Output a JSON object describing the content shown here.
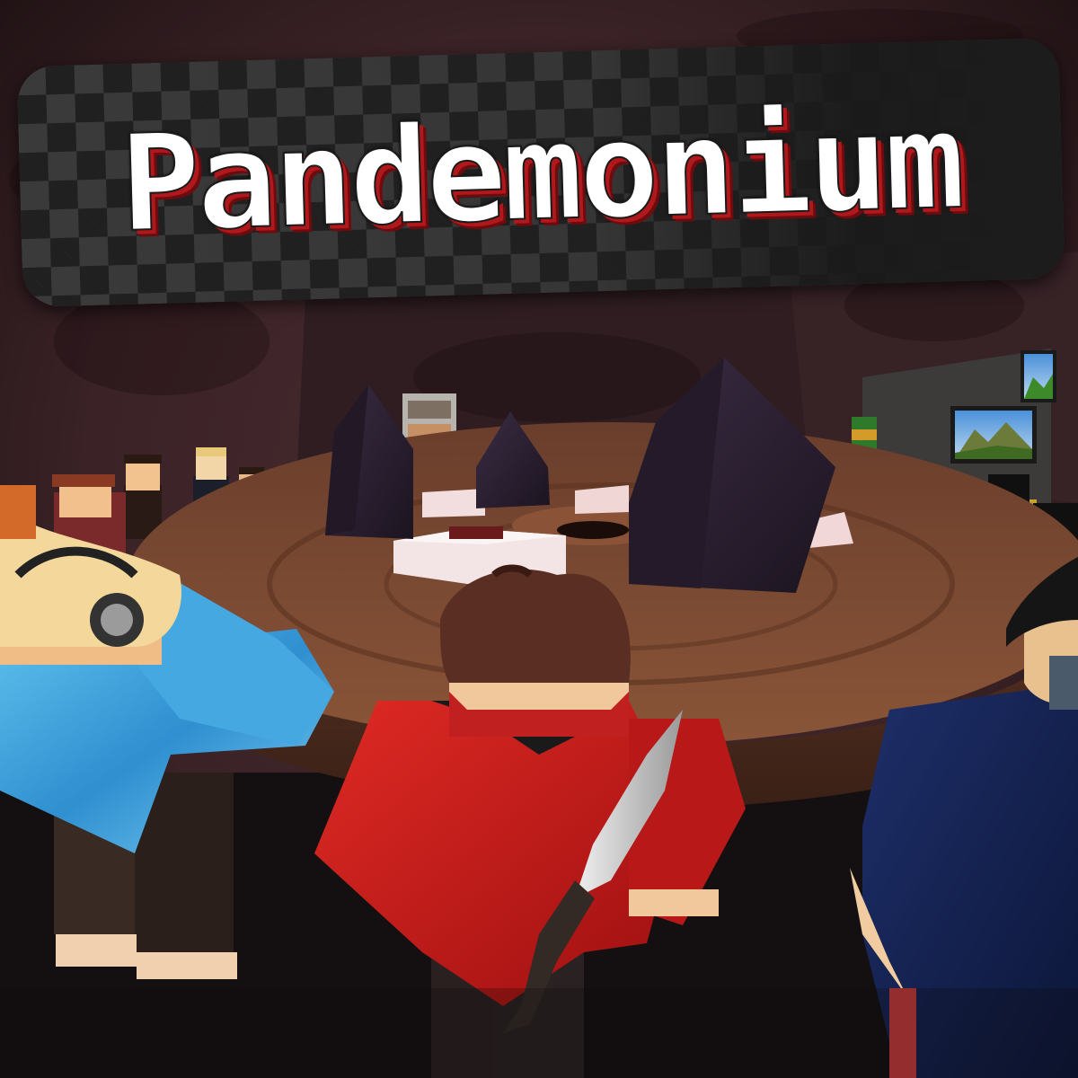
{
  "title": "Pandemonium",
  "colors": {
    "cave_wall": "#3a2226",
    "table_wood": "#7a4a33",
    "crystal": "#2b2030",
    "title_shadow": "#b0181c",
    "checker_dark": "#202020",
    "checker_light": "#3a3a3a",
    "floor": "#141012"
  },
  "scene": {
    "elements": [
      "round-table",
      "dark-crystals",
      "pillows",
      "central-pit",
      "players",
      "knife",
      "landscape-paintings",
      "bookshelf"
    ]
  }
}
